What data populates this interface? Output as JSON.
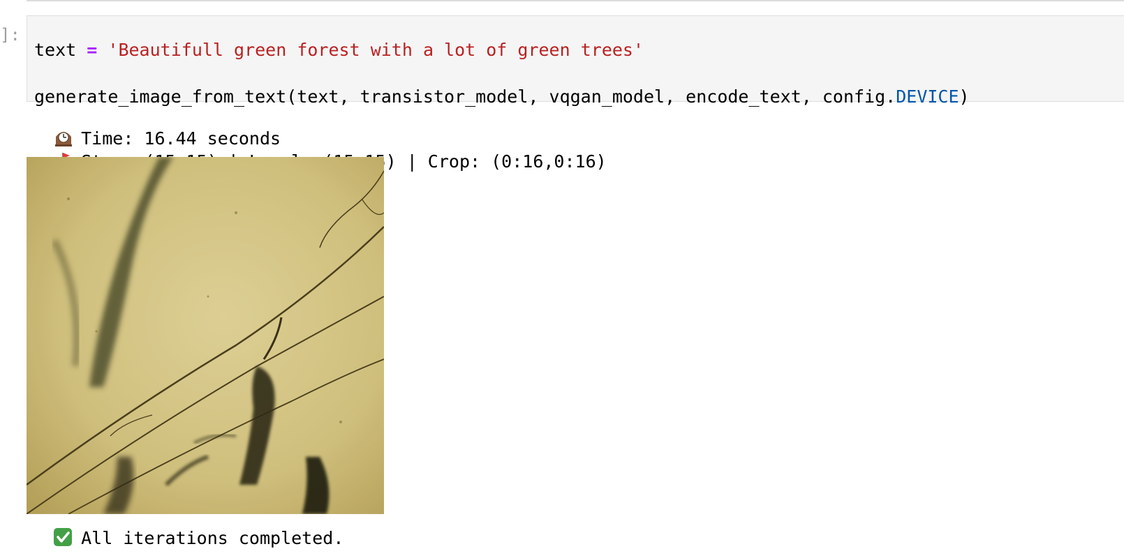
{
  "notebook": {
    "prompt_label": "]:",
    "cell": {
      "line1": {
        "var": "text",
        "op": "=",
        "string": "'Beautifull green forest with a lot of green trees'"
      },
      "line2": {
        "call": "generate_image_from_text(text, transistor_model, vqgan_model, encode_text, config.",
        "attr": "DEVICE",
        "close": ")"
      }
    },
    "output": {
      "time_text": "Time: 16.44 seconds",
      "step_text": "Step: (15,15) | Local: (15,15) | Crop: (0:16,0:16)",
      "done_text": "All iterations completed.",
      "time_icon": "mantelpiece-clock-icon",
      "step_icon": "golf-flag-icon",
      "done_icon": "check-mark-button-icon"
    },
    "colors": {
      "string": "#ba2121",
      "operator": "#aa22ff",
      "attribute": "#0055aa",
      "cell_background": "#f5f5f5",
      "image_base": "#d8c98a"
    }
  }
}
